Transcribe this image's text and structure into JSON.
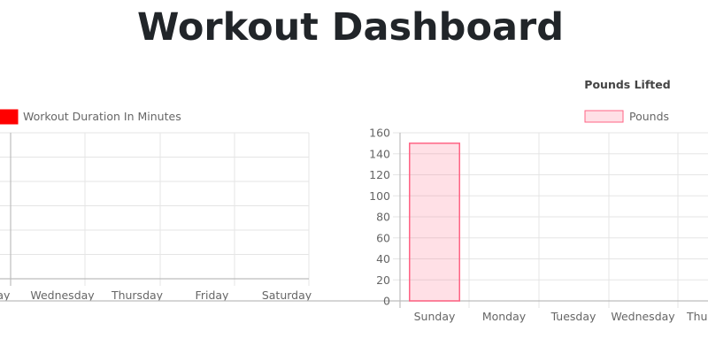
{
  "page": {
    "title": "Workout Dashboard"
  },
  "chart_data": [
    {
      "type": "bar",
      "title": "",
      "legend": {
        "label": "Workout Duration In Minutes",
        "color": "#ff0000",
        "position": "top"
      },
      "categories": [
        "Tuesday",
        "Wednesday",
        "Thursday",
        "Friday",
        "Saturday"
      ],
      "series": [
        {
          "name": "Workout Duration In Minutes",
          "values": [
            0,
            0,
            0,
            0,
            0
          ]
        }
      ],
      "xlabel": "",
      "ylabel": "",
      "grid": true
    },
    {
      "type": "bar",
      "title": "Pounds Lifted",
      "legend": {
        "label": "Pounds",
        "color": "#ff6384",
        "position": "top"
      },
      "categories": [
        "Sunday",
        "Monday",
        "Tuesday",
        "Wednesday",
        "Thursday"
      ],
      "series": [
        {
          "name": "Pounds",
          "values": [
            150,
            0,
            0,
            0,
            0
          ]
        }
      ],
      "xlabel": "",
      "ylabel": "",
      "ylim": [
        0,
        160
      ],
      "yticks": [
        "0",
        "20",
        "40",
        "60",
        "80",
        "100",
        "120",
        "140",
        "160"
      ],
      "grid": true
    }
  ]
}
